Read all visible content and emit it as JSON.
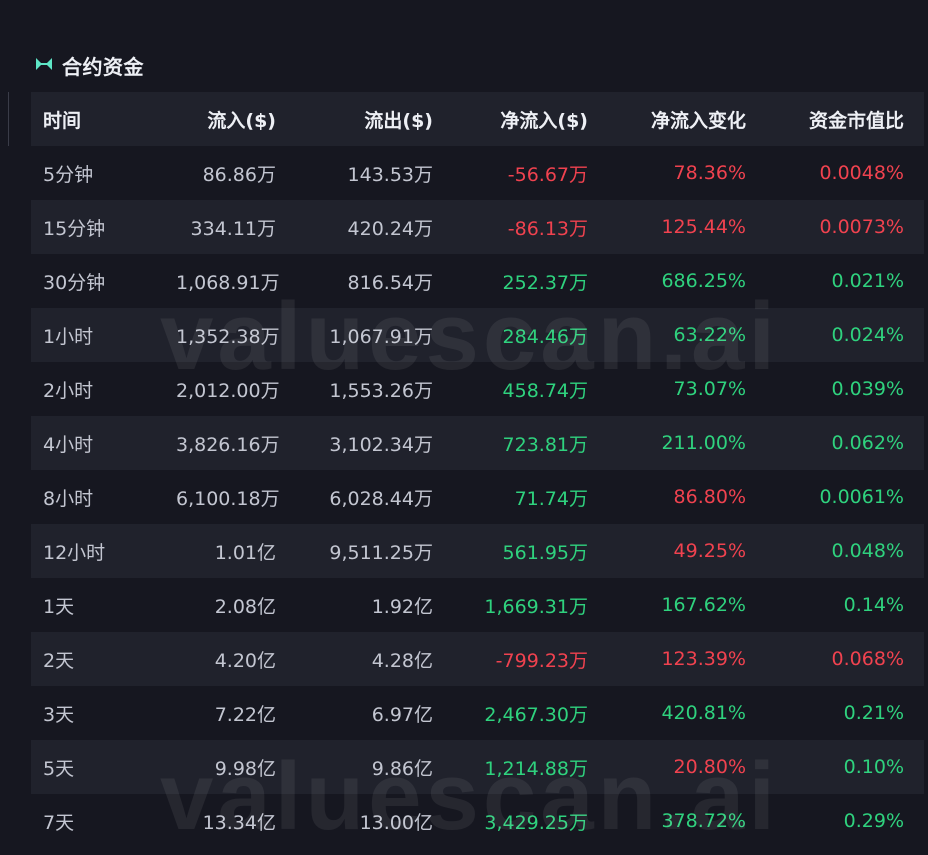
{
  "section": {
    "title": "合约资金",
    "icon": "infinity-icon"
  },
  "watermark": {
    "text": "valuescan.ai"
  },
  "colors": {
    "up": "#2fd27e",
    "down": "#f0424f",
    "accent": "#5ee6c6"
  },
  "table": {
    "headers": [
      "时间",
      "流入($)",
      "流出($)",
      "净流入($)",
      "净流入变化",
      "资金市值比"
    ],
    "rows": [
      {
        "time": "5分钟",
        "inflow": "86.86万",
        "outflow": "143.53万",
        "net": "-56.67万",
        "net_dir": "down",
        "change": "78.36%",
        "change_dir": "down",
        "ratio": "0.0048%",
        "ratio_dir": "down"
      },
      {
        "time": "15分钟",
        "inflow": "334.11万",
        "outflow": "420.24万",
        "net": "-86.13万",
        "net_dir": "down",
        "change": "125.44%",
        "change_dir": "down",
        "ratio": "0.0073%",
        "ratio_dir": "down"
      },
      {
        "time": "30分钟",
        "inflow": "1,068.91万",
        "outflow": "816.54万",
        "net": "252.37万",
        "net_dir": "up",
        "change": "686.25%",
        "change_dir": "up",
        "ratio": "0.021%",
        "ratio_dir": "up"
      },
      {
        "time": "1小时",
        "inflow": "1,352.38万",
        "outflow": "1,067.91万",
        "net": "284.46万",
        "net_dir": "up",
        "change": "63.22%",
        "change_dir": "up",
        "ratio": "0.024%",
        "ratio_dir": "up"
      },
      {
        "time": "2小时",
        "inflow": "2,012.00万",
        "outflow": "1,553.26万",
        "net": "458.74万",
        "net_dir": "up",
        "change": "73.07%",
        "change_dir": "up",
        "ratio": "0.039%",
        "ratio_dir": "up"
      },
      {
        "time": "4小时",
        "inflow": "3,826.16万",
        "outflow": "3,102.34万",
        "net": "723.81万",
        "net_dir": "up",
        "change": "211.00%",
        "change_dir": "up",
        "ratio": "0.062%",
        "ratio_dir": "up"
      },
      {
        "time": "8小时",
        "inflow": "6,100.18万",
        "outflow": "6,028.44万",
        "net": "71.74万",
        "net_dir": "up",
        "change": "86.80%",
        "change_dir": "down",
        "ratio": "0.0061%",
        "ratio_dir": "up"
      },
      {
        "time": "12小时",
        "inflow": "1.01亿",
        "outflow": "9,511.25万",
        "net": "561.95万",
        "net_dir": "up",
        "change": "49.25%",
        "change_dir": "down",
        "ratio": "0.048%",
        "ratio_dir": "up"
      },
      {
        "time": "1天",
        "inflow": "2.08亿",
        "outflow": "1.92亿",
        "net": "1,669.31万",
        "net_dir": "up",
        "change": "167.62%",
        "change_dir": "up",
        "ratio": "0.14%",
        "ratio_dir": "up"
      },
      {
        "time": "2天",
        "inflow": "4.20亿",
        "outflow": "4.28亿",
        "net": "-799.23万",
        "net_dir": "down",
        "change": "123.39%",
        "change_dir": "down",
        "ratio": "0.068%",
        "ratio_dir": "down"
      },
      {
        "time": "3天",
        "inflow": "7.22亿",
        "outflow": "6.97亿",
        "net": "2,467.30万",
        "net_dir": "up",
        "change": "420.81%",
        "change_dir": "up",
        "ratio": "0.21%",
        "ratio_dir": "up"
      },
      {
        "time": "5天",
        "inflow": "9.98亿",
        "outflow": "9.86亿",
        "net": "1,214.88万",
        "net_dir": "up",
        "change": "20.80%",
        "change_dir": "down",
        "ratio": "0.10%",
        "ratio_dir": "up"
      },
      {
        "time": "7天",
        "inflow": "13.34亿",
        "outflow": "13.00亿",
        "net": "3,429.25万",
        "net_dir": "up",
        "change": "378.72%",
        "change_dir": "up",
        "ratio": "0.29%",
        "ratio_dir": "up"
      }
    ]
  }
}
